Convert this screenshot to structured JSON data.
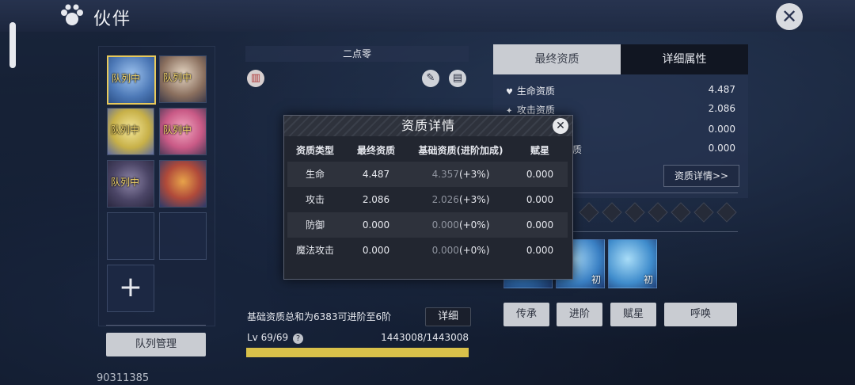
{
  "header": {
    "title": "伙伴"
  },
  "team": {
    "slots": [
      {
        "tag": "队列中"
      },
      {
        "tag": "队列中"
      },
      {
        "tag": "队列中"
      },
      {
        "tag": "队列中"
      },
      {
        "tag": "队列中"
      },
      {
        "tag": ""
      }
    ],
    "add_label": "+",
    "manage_label": "队列管理",
    "uid": "90311385"
  },
  "character": {
    "name": "二点零",
    "info_text": "基础资质总和为6383可进阶至6阶",
    "detail_label": "详细",
    "level_text": "Lv 69/69",
    "help_mark": "?",
    "exp_text": "1443008/1443008",
    "exp_fraction": 1.0
  },
  "right_panel": {
    "tab_final": "最终资质",
    "tab_detail": "详细属性",
    "attributes": [
      {
        "icon": "heart-icon",
        "glyph": "♥",
        "label": "生命资质",
        "value": "4.487"
      },
      {
        "icon": "sword-icon",
        "glyph": "✦",
        "label": "攻击资质",
        "value": "2.086"
      },
      {
        "icon": "",
        "glyph": "",
        "label": "",
        "value": "0.000"
      },
      {
        "icon": "",
        "glyph": "",
        "label": "质",
        "value": "0.000"
      }
    ],
    "aptitude_detail_label": "资质详情>>",
    "skill_labels": [
      "",
      "初",
      "初"
    ],
    "buttons": [
      "传承",
      "进阶",
      "赋星",
      "呼唤"
    ]
  },
  "modal": {
    "title": "资质详情",
    "headers": [
      "资质类型",
      "最终资质",
      "基础资质(进阶加成)",
      "赋星"
    ],
    "rows": [
      {
        "type": "生命",
        "final": "4.487",
        "base": "4.357",
        "bonus": "(+3%)",
        "star": "0.000"
      },
      {
        "type": "攻击",
        "final": "2.086",
        "base": "2.026",
        "bonus": "(+3%)",
        "star": "0.000"
      },
      {
        "type": "防御",
        "final": "0.000",
        "base": "0.000",
        "bonus": "(+0%)",
        "star": "0.000"
      },
      {
        "type": "魔法攻击",
        "final": "0.000",
        "base": "0.000",
        "bonus": "(+0%)",
        "star": "0.000"
      }
    ]
  },
  "colors": {
    "accent_gold": "#e8c95a",
    "exp_bar": "#d9c14a",
    "button_bg": "#c9ccd2"
  }
}
